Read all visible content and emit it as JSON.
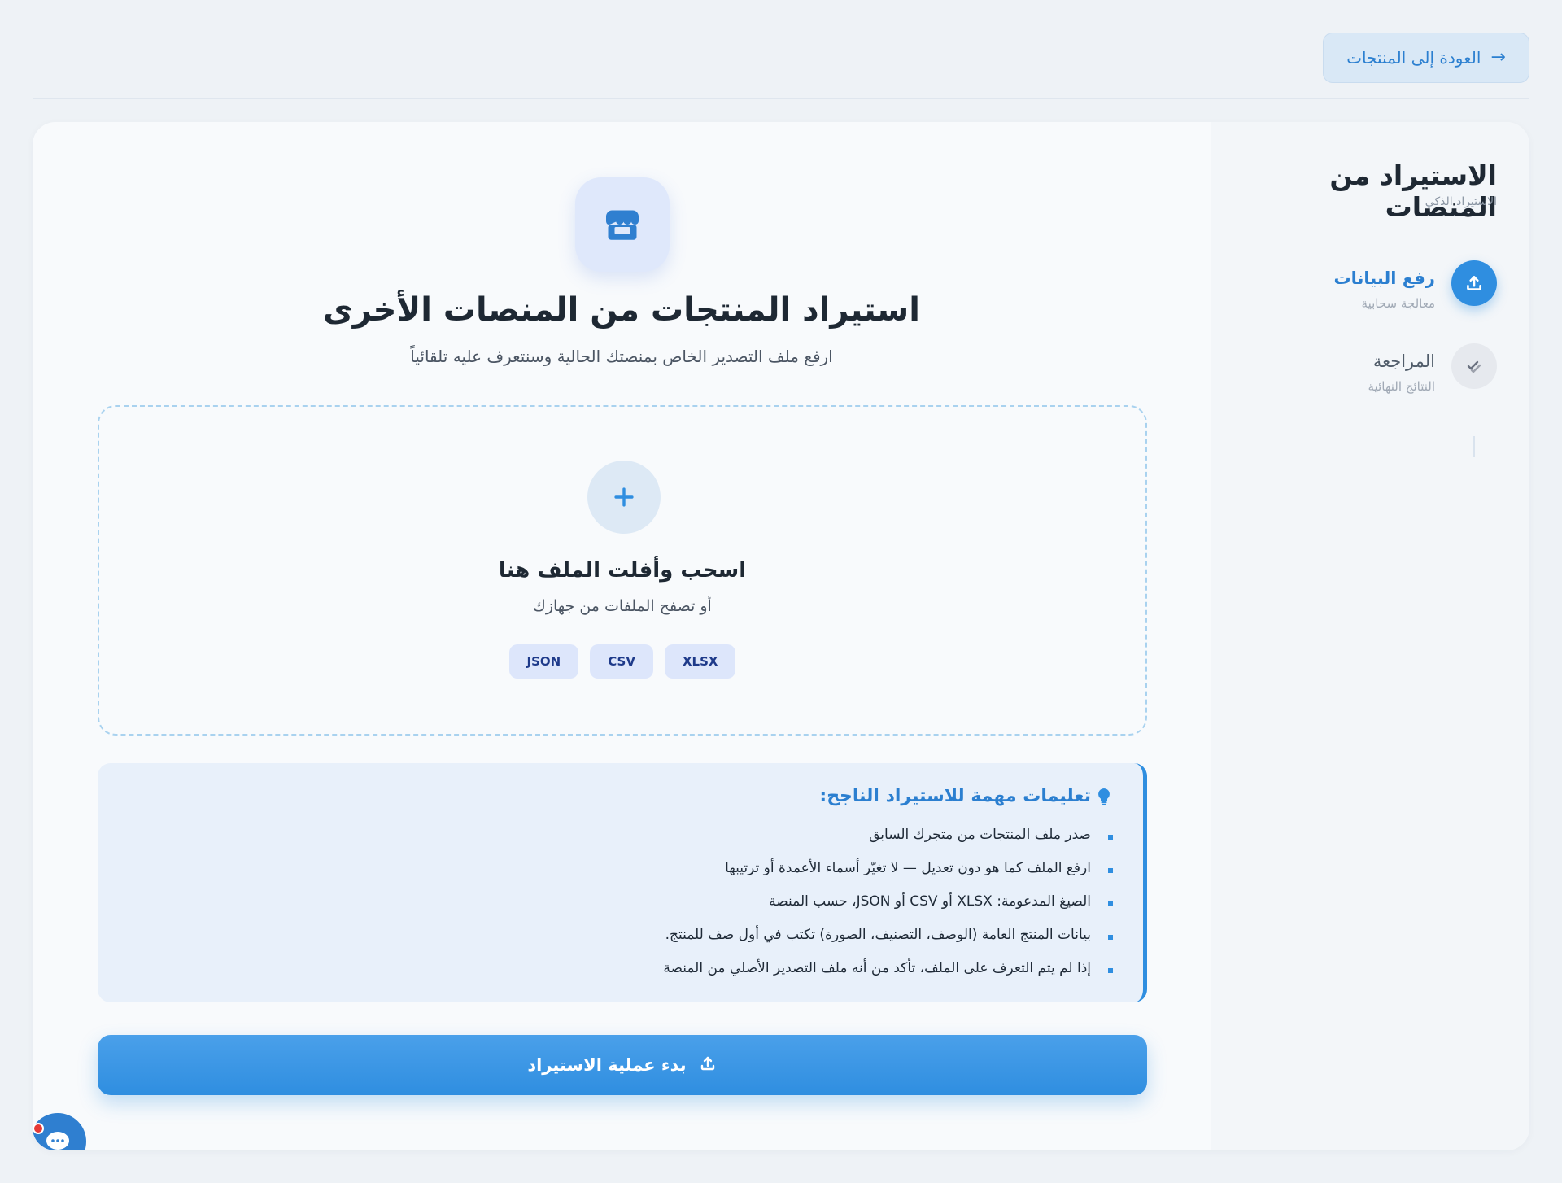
{
  "header": {
    "back_label": "العودة إلى المنتجات"
  },
  "sidebar": {
    "title": "الاستيراد من المنصات",
    "subtitle": "الاستيراد  الذكي",
    "steps": [
      {
        "label": "رفع البيانات",
        "sub": "معالجة سحابية",
        "state": "active"
      },
      {
        "label": "المراجعة",
        "sub": "النتائج النهائية",
        "state": "pending"
      }
    ]
  },
  "main": {
    "title": "استيراد المنتجات من المنصات الأخرى",
    "subtitle": "ارفع ملف التصدير الخاص بمنصتك الحالية وسنتعرف عليه تلقائياً",
    "dropzone": {
      "title": "اسحب وأفلت الملف هنا",
      "subtitle": "أو تصفح الملفات من جهازك",
      "formats": [
        "XLSX",
        "CSV",
        "JSON"
      ]
    },
    "tips": {
      "title": "تعليمات مهمة للاستيراد الناجح:",
      "items": [
        "صدر ملف المنتجات من متجرك السابق",
        "ارفع الملف كما هو دون تعديل — لا تغيّر أسماء الأعمدة أو ترتيبها",
        "الصيغ المدعومة: XLSX أو CSV أو JSON، حسب المنصة",
        "بيانات المنتج العامة (الوصف، التصنيف، الصورة) تكتب في أول صف للمنتج.",
        "إذا لم يتم التعرف على الملف، تأكد من أنه ملف التصدير الأصلي من المنصة"
      ]
    },
    "start_label": "بدء عملية الاستيراد"
  },
  "colors": {
    "accent": "#2f8ee0",
    "background": "#eef2f6",
    "chip_bg": "#dde6fb"
  }
}
